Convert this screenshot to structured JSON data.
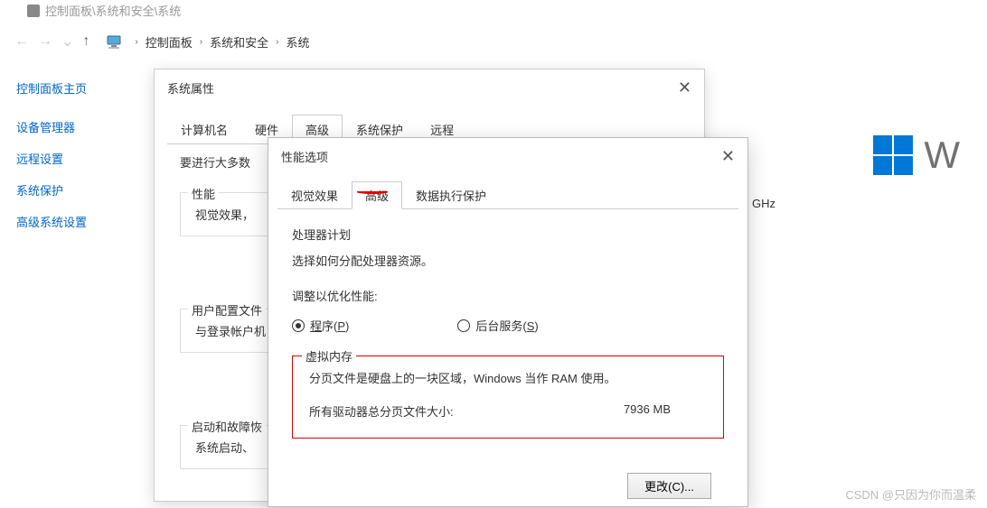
{
  "window_title": "控制面板\\系统和安全\\系统",
  "breadcrumb": [
    "控制面板",
    "系统和安全",
    "系统"
  ],
  "sidebar": {
    "items": [
      {
        "label": "控制面板主页"
      },
      {
        "label": "设备管理器"
      },
      {
        "label": "远程设置"
      },
      {
        "label": "系统保护"
      },
      {
        "label": "高级系统设置"
      }
    ]
  },
  "bg": {
    "ghz": "GHz",
    "win_letter": "W"
  },
  "dialog1": {
    "title": "系统属性",
    "tabs": [
      "计算机名",
      "硬件",
      "高级",
      "系统保护",
      "远程"
    ],
    "active_tab": 2,
    "intro": "要进行大多数",
    "group_perf": {
      "label": "性能",
      "desc": "视觉效果，"
    },
    "group_user": {
      "label": "用户配置文件",
      "desc": "与登录帐户机"
    },
    "group_boot": {
      "label": "启动和故障恢",
      "desc": "系统启动、"
    }
  },
  "dialog2": {
    "title": "性能选项",
    "tabs": [
      "视觉效果",
      "高级",
      "数据执行保护"
    ],
    "active_tab": 1,
    "cpu_section": "处理器计划",
    "cpu_desc": "选择如何分配处理器资源。",
    "adjust_label": "调整以优化性能:",
    "radio_programs": "程序(P)",
    "radio_bg": "后台服务(S)",
    "vm_title": "虚拟内存",
    "vm_desc": "分页文件是硬盘上的一块区域，Windows 当作 RAM 使用。",
    "vm_total_label": "所有驱动器总分页文件大小:",
    "vm_total_value": "7936 MB",
    "change_btn": "更改(C)..."
  },
  "watermark": "CSDN @只因为你而温柔"
}
